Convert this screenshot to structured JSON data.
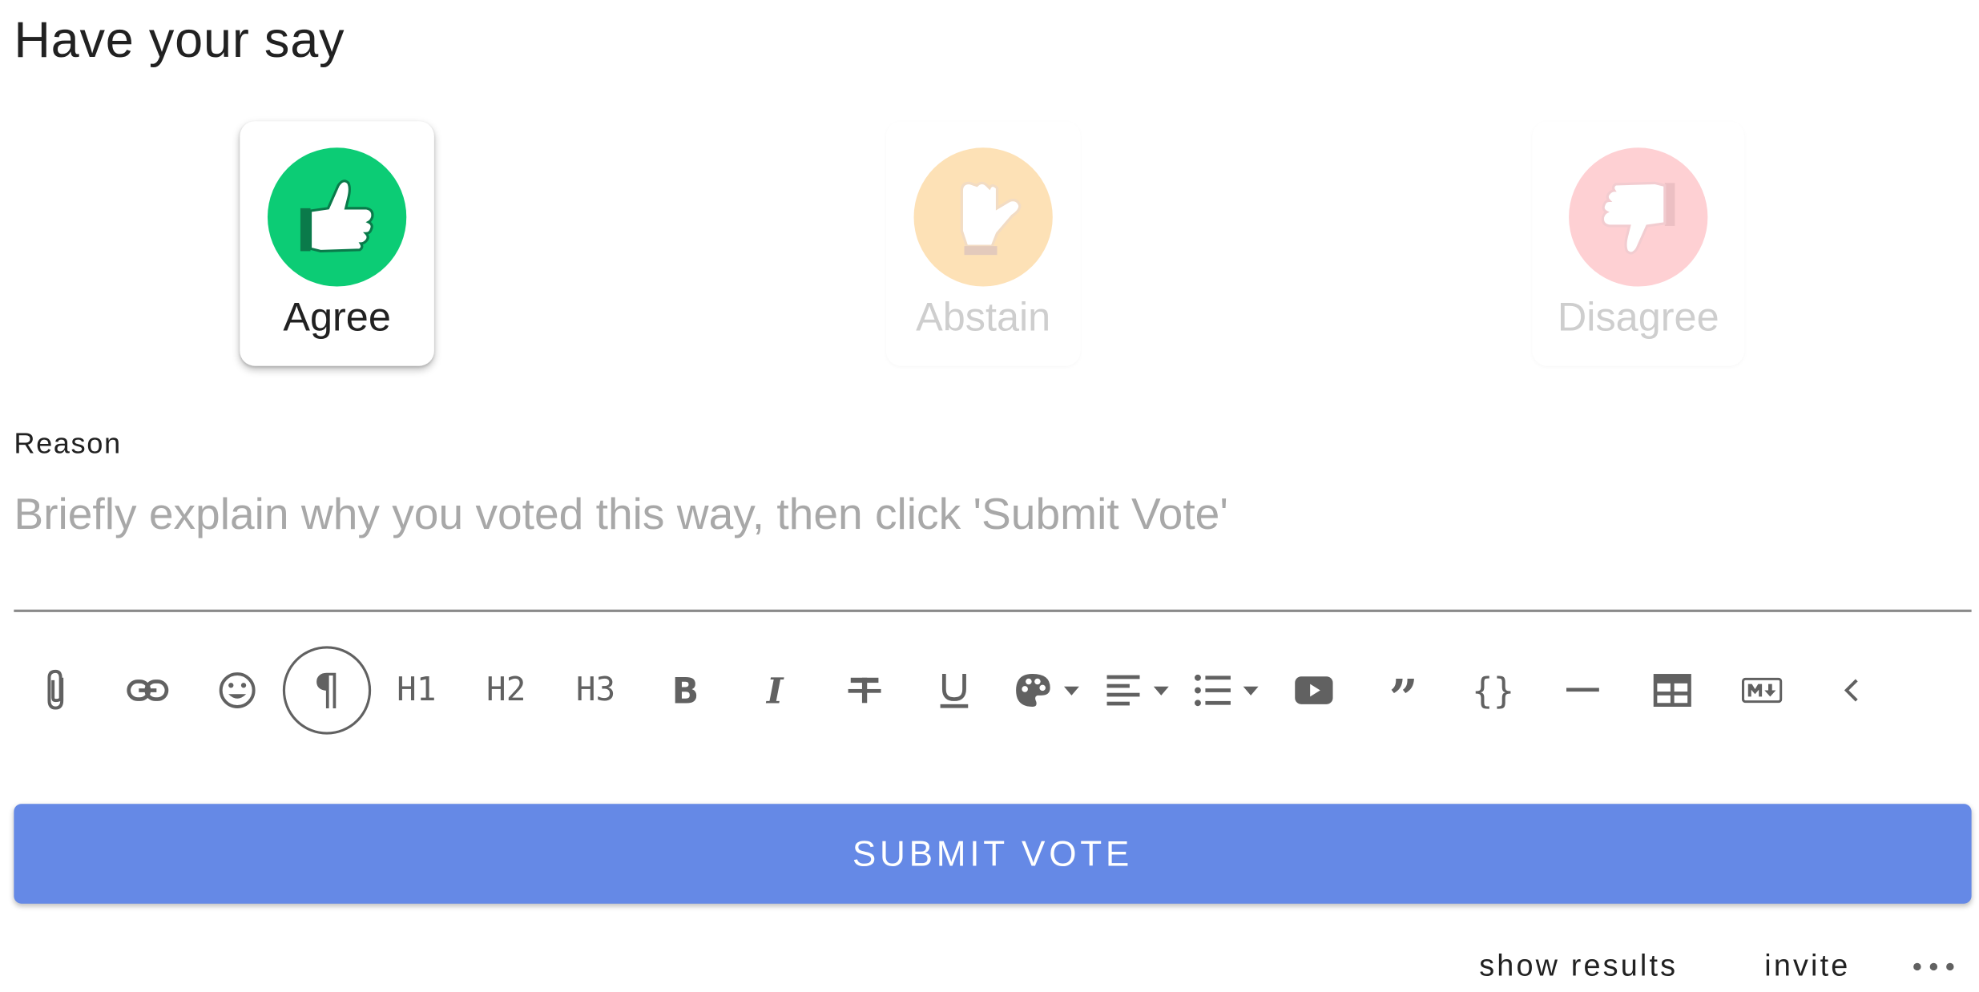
{
  "title": "Have your say",
  "votes": [
    {
      "label": "Agree",
      "icon": "thumbs-up-icon",
      "color": "#0ccc75",
      "selected": true
    },
    {
      "label": "Abstain",
      "icon": "thumbs-sideways-icon",
      "color": "#fdd59a",
      "selected": false
    },
    {
      "label": "Disagree",
      "icon": "thumbs-down-icon",
      "color": "#fda1a8",
      "selected": false
    }
  ],
  "reason": {
    "label": "Reason",
    "placeholder": "Briefly explain why you voted this way, then click 'Submit Vote'",
    "value": ""
  },
  "toolbar": {
    "h1": "H1",
    "h2": "H2",
    "h3": "H3",
    "icons": [
      "paperclip-icon",
      "link-icon",
      "emoji-icon",
      "paragraph-icon",
      "h1-icon",
      "h2-icon",
      "h3-icon",
      "bold-icon",
      "italic-icon",
      "strikethrough-icon",
      "underline-icon",
      "palette-icon",
      "align-icon",
      "list-icon",
      "video-icon",
      "quote-icon",
      "code-icon",
      "horizontal-rule-icon",
      "table-icon",
      "markdown-icon",
      "chevron-left-icon"
    ]
  },
  "submit_label": "SUBMIT VOTE",
  "footer": {
    "show_results": "show results",
    "invite": "invite"
  }
}
